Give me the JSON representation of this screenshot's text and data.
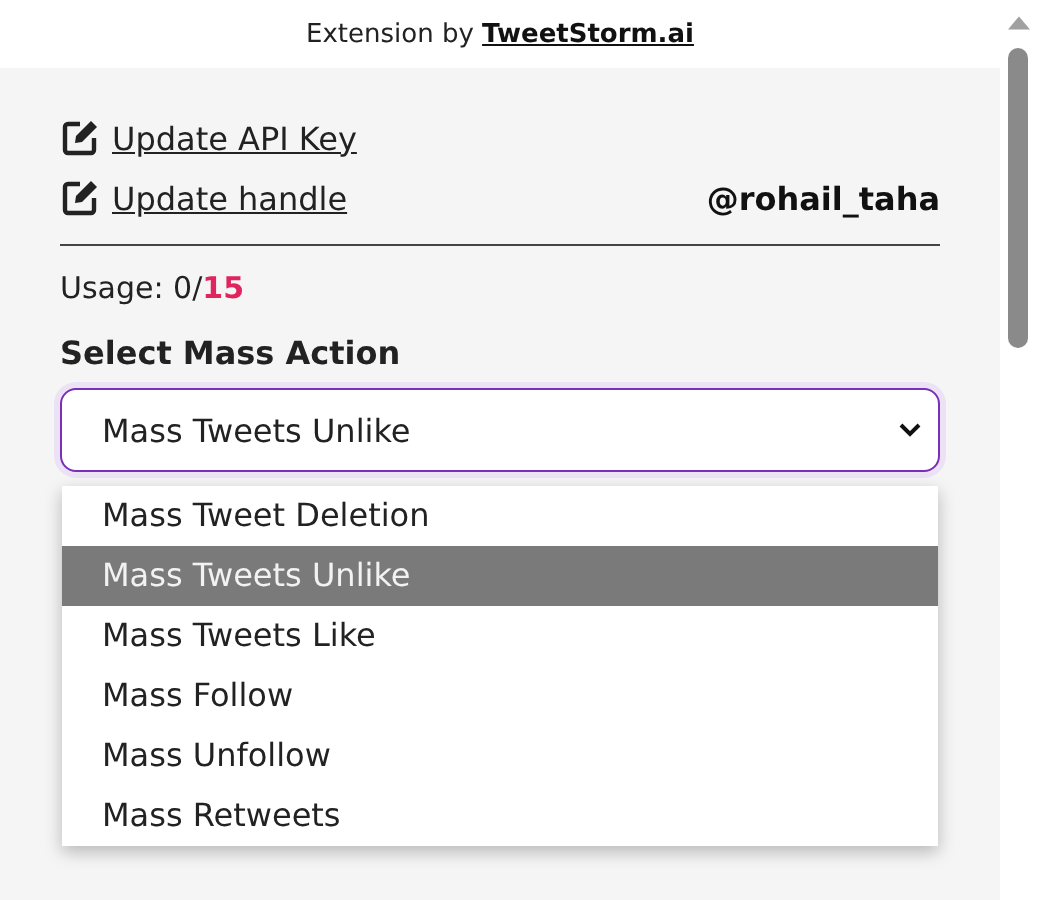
{
  "credit": {
    "text": "Extension by",
    "link": "TweetStorm.ai"
  },
  "links": [
    {
      "label": "Update API Key"
    },
    {
      "label": "Update handle"
    }
  ],
  "handle": "@rohail_taha",
  "usage": "Usage:  0/**15**",
  "select": {
    "label": "Select Mass Action",
    "value": "Mass Tweets Unlike",
    "expanded": true,
    "options": [
      {
        "label": "Mass Tweet Deletion",
        "selected": false
      },
      {
        "label": "Mass Tweets Unlike",
        "selected": true
      },
      {
        "label": "Mass Tweets Like",
        "selected": false
      },
      {
        "label": "Mass Follow",
        "selected": false
      },
      {
        "label": "Mass Unfollow",
        "selected": false
      },
      {
        "label": "Mass Retweets",
        "selected": false
      }
    ]
  }
}
